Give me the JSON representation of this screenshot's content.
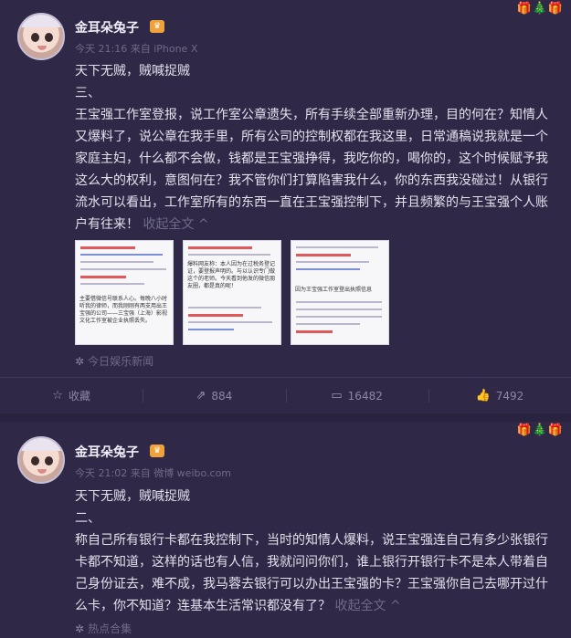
{
  "posts": [
    {
      "user": {
        "name": "金耳朵兔子",
        "badge_icon": "vip-crown-icon"
      },
      "meta": "今天 21:16 来自 iPhone X",
      "lines": [
        "天下无贼，贼喊捉贼",
        "三、",
        "王宝强工作室登报，说工作室公章遗失，所有手续全部重新办理，目的何在？知情人又爆料了，说公章在我手里，所有公司的控制权都在我这里，日常通稿说我就是一个家庭主妇，什么都不会做，钱都是王宝强挣得，我吃你的，喝你的，这个时候赋予我这么大的权利，意图何在？我不管你们打算陷害我什么，你的东西我没碰过！从银行流水可以看出，工作室所有的东西一直在王宝强控制下，并且频繁的与王宝强个人账户有往来！"
      ],
      "collapse_label": "收起全文 ^",
      "thumbnails": [
        {
          "caption": "主要借微信号联系人心。每晚八小时听我的律师，而我刚刚有两支用出王宝强的公司——三宝强（上海）影视文化工作室被企业执照丢失。"
        },
        {
          "caption": "爆料网友称：本人因为在过税务登记证，要登报声明的。与以认识专门做这个的老师。今天看到他发的微信朋友圈，都是真的呢！"
        },
        {
          "caption": "因为王宝强工作室登出执照信息"
        }
      ],
      "source": "今日娱乐新闻",
      "actions": [
        {
          "icon": "star-icon",
          "label": "收藏"
        },
        {
          "icon": "share-icon",
          "label": "884"
        },
        {
          "icon": "comment-icon",
          "label": "16482"
        },
        {
          "icon": "like-icon",
          "label": "7492"
        }
      ]
    },
    {
      "user": {
        "name": "金耳朵兔子",
        "badge_icon": "vip-crown-icon"
      },
      "meta": "今天 21:02 来自 微博 weibo.com",
      "lines": [
        "天下无贼，贼喊捉贼",
        "二、",
        "称自己所有银行卡都在我控制下，当时的知情人爆料，说王宝强连自己有多少张银行卡都不知道，这样的话也有人信，我就问问你们，谁上银行开银行卡不是本人带着自己身份证去，难不成，我马蓉去银行可以办出王宝强的卡？王宝强你自己去哪开过什么卡，你不知道？连基本生活常识都没有了？"
      ],
      "collapse_label": "收起全文 ^",
      "source": "热点合集"
    }
  ],
  "colors": {
    "background": "#2a2340",
    "card": "#2f2947",
    "muted": "#6f6a86",
    "badge": "#f0a23a"
  }
}
